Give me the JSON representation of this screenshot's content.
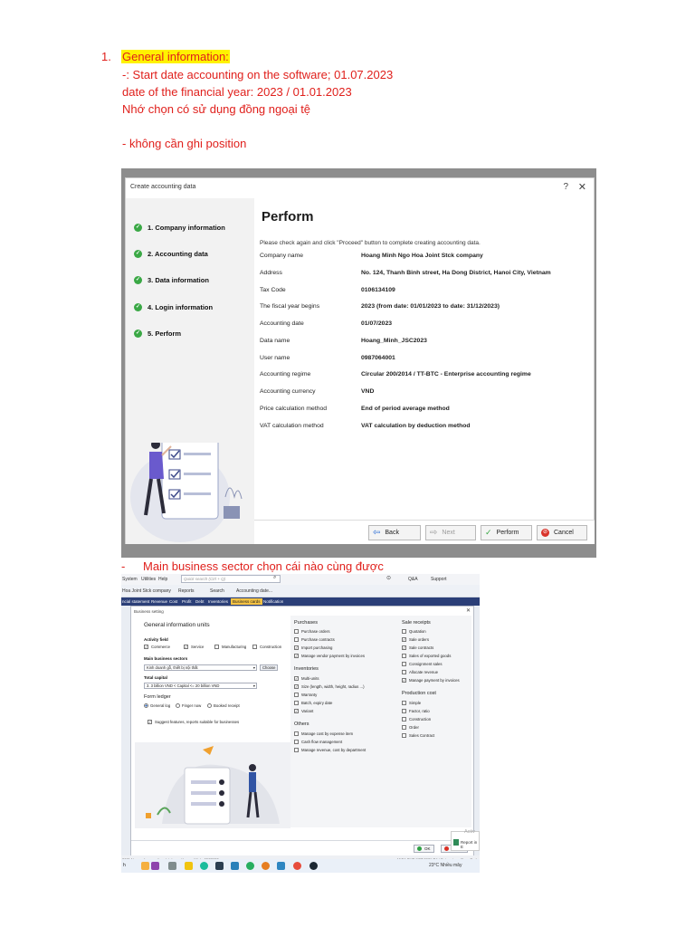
{
  "notes": {
    "item_number": "1.",
    "heading": "General information:",
    "lines": [
      "-: Start date accounting on the software; 01.07.2023",
      "date of the financial year: 2023 / 01.01.2023",
      "Nhớ chọn có sử dụng đồng ngoại tệ",
      "- không cần ghi position"
    ],
    "dash": "-",
    "sector_note": "Main business sector chọn cái nào cùng được"
  },
  "dialog": {
    "title": "Create accounting data",
    "help_glyph": "?",
    "close_glyph": "✕",
    "steps": [
      "1. Company information",
      "2. Accounting data",
      "3. Data information",
      "4. Login information",
      "5. Perform"
    ],
    "heading": "Perform",
    "instruction": "Please check again and click \"Proceed\" button to complete creating accounting data.",
    "fields": [
      {
        "key": "Company name",
        "value": "Hoang Minh Ngo Hoa Joint Stck company"
      },
      {
        "key": "Address",
        "value": "No. 124, Thanh Binh street, Ha Dong District, Hanoi City, Vietnam"
      },
      {
        "key": "Tax Code",
        "value": "0106134109"
      },
      {
        "key": "The fiscal year begins",
        "value": "2023 (from date: 01/01/2023 to date: 31/12/2023)"
      },
      {
        "key": "Accounting date",
        "value": "01/07/2023"
      },
      {
        "key": "Data name",
        "value": "Hoang_Minh_JSC2023"
      },
      {
        "key": "User name",
        "value": "0987064001"
      },
      {
        "key": "Accounting regime",
        "value": "Circular 200/2014 / TT-BTC - Enterprise accounting regime"
      },
      {
        "key": "Accounting currency",
        "value": "VND"
      },
      {
        "key": "Price calculation method",
        "value": "End of period average method"
      },
      {
        "key": "VAT calculation method",
        "value": "VAT calculation by deduction method"
      }
    ],
    "buttons": {
      "back": "Back",
      "next": "Next",
      "perform": "Perform",
      "cancel": "Cancel"
    }
  },
  "app": {
    "menu": [
      "System",
      "Utilities",
      "Help"
    ],
    "quick_search": "Quick search (Ctrl + Q)",
    "qa": "Q&A",
    "support": "Support",
    "company": "Hoa Joint Stck company",
    "toolbar": [
      "Reports",
      "Search",
      "Accounting date..."
    ],
    "tabs": [
      "ncial statement",
      "Revenue",
      "Cost",
      "Profit",
      "Debt",
      "Inventories",
      "Business cards",
      "Notification"
    ],
    "active_tab": "Business cards"
  },
  "business_setting": {
    "title": "Business setting",
    "close_glyph": "✕",
    "general_heading": "General information units",
    "activity_field_label": "Activity field",
    "activity_fields": [
      {
        "label": "Commerce",
        "checked": true
      },
      {
        "label": "Service",
        "checked": true
      },
      {
        "label": "Manufacturing",
        "checked": false
      },
      {
        "label": "Construction",
        "checked": false
      }
    ],
    "main_sectors_label": "Main business sectors",
    "main_sector_value": "Kinh doanh gỗ, thiết bị nội thất",
    "choose_label": "Choose",
    "total_capital_label": "Total capital",
    "total_capital_value": "3. 3 billion VND < Capital <= 20 billion VND",
    "form_ledger_heading": "Form ledger",
    "ledger_options": [
      {
        "label": "General log",
        "selected": true
      },
      {
        "label": "Finger now",
        "selected": false
      },
      {
        "label": "Booked receipt",
        "selected": false
      }
    ],
    "suggest_label": "Suggest features, reports suitable for businesses",
    "suggest_checked": true,
    "purchases_heading": "Purchases",
    "purchases": [
      {
        "label": "Purchase orders",
        "checked": false
      },
      {
        "label": "Purchase contracts",
        "checked": false
      },
      {
        "label": "Import purchasing",
        "checked": true
      },
      {
        "label": "Manage vendor payment by invoices",
        "checked": true
      }
    ],
    "inventories_heading": "Inventories",
    "inventories": [
      {
        "label": "Multi-units",
        "checked": true
      },
      {
        "label": "Size (length, width, height, radius ...)",
        "checked": true
      },
      {
        "label": "Warranty",
        "checked": false
      },
      {
        "label": "Batch, expiry date",
        "checked": false
      },
      {
        "label": "Variant",
        "checked": true
      }
    ],
    "others_heading": "Others",
    "others": [
      {
        "label": "Manage cost by expense item",
        "checked": false
      },
      {
        "label": "Cash flow management",
        "checked": false
      },
      {
        "label": "Manage revenue, cost by department",
        "checked": false
      }
    ],
    "sale_heading": "Sale receipts",
    "sales": [
      {
        "label": "Quotation",
        "checked": false
      },
      {
        "label": "Sale orders",
        "checked": true
      },
      {
        "label": "Sale contracts",
        "checked": true
      },
      {
        "label": "Sales of exported goods",
        "checked": false
      },
      {
        "label": "Consignment sales",
        "checked": false
      },
      {
        "label": "Allocate revenue",
        "checked": false
      },
      {
        "label": "Manage payment by invoices",
        "checked": true
      }
    ],
    "production_heading": "Production cost",
    "production": [
      {
        "label": "Simple",
        "checked": false
      },
      {
        "label": "Factor, ratio",
        "checked": false
      },
      {
        "label": "Construction",
        "checked": false
      },
      {
        "label": "Order",
        "checked": false
      },
      {
        "label": "Sales Contract",
        "checked": false
      }
    ],
    "ok_label": "OK",
    "cancel_label": "Cancel"
  },
  "statusbar": {
    "left": "2021   Name of accounting database: Hoang_Minh_JSC2023",
    "right": "MISA SME.NET 2021 R4 / Enterprise - Khoa Quốc"
  },
  "report_widget": {
    "label": "Report in E",
    "activation": "Activ"
  },
  "taskbar": {
    "start": "h",
    "weather": "23°C  Nhiều mây"
  }
}
